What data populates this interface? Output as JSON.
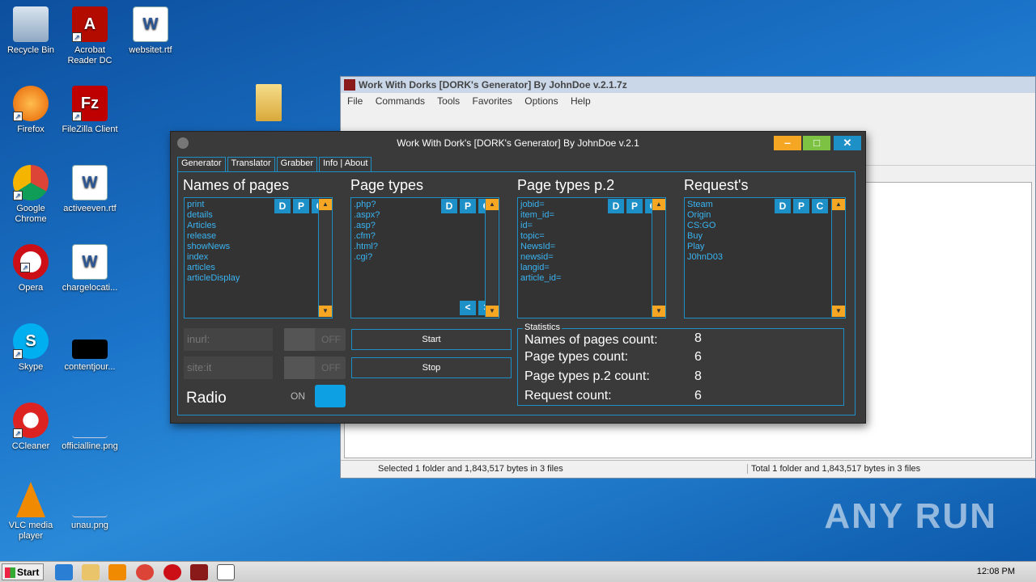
{
  "desktop": {
    "icons": [
      {
        "label": "Recycle Bin",
        "icon": "recycle-bin-icon"
      },
      {
        "label": "Acrobat Reader DC",
        "icon": "acrobat-icon"
      },
      {
        "label": "websitet.rtf",
        "icon": "word-doc-icon"
      },
      {
        "label": "Firefox",
        "icon": "firefox-icon"
      },
      {
        "label": "FileZilla Client",
        "icon": "filezilla-icon"
      },
      {
        "label": "Google Chrome",
        "icon": "chrome-icon"
      },
      {
        "label": "activeeven.rtf",
        "icon": "word-doc-icon"
      },
      {
        "label": "Opera",
        "icon": "opera-icon"
      },
      {
        "label": "chargelocati...",
        "icon": "word-doc-icon"
      },
      {
        "label": "Skype",
        "icon": "skype-icon"
      },
      {
        "label": "contentjour...",
        "icon": "image-file-icon"
      },
      {
        "label": "CCleaner",
        "icon": "ccleaner-icon"
      },
      {
        "label": "officialline.png",
        "icon": "image-file-icon"
      },
      {
        "label": "VLC media player",
        "icon": "vlc-icon"
      },
      {
        "label": "unau.png",
        "icon": "image-file-icon"
      }
    ]
  },
  "zip_window": {
    "title": "Work With Dorks [DORK's Generator] By JohnDoe v.2.1.7z",
    "menu": [
      "File",
      "Commands",
      "Tools",
      "Favorites",
      "Options",
      "Help"
    ],
    "status_left": "Selected 1 folder and 1,843,517 bytes in 3 files",
    "status_right": "Total 1 folder and 1,843,517 bytes in 3 files"
  },
  "app": {
    "title": "Work With Dork's [DORK's Generator] By JohnDoe v.2.1",
    "tabs": [
      "Generator",
      "Translator",
      "Grabber",
      "Info | About"
    ],
    "dpc": [
      "D",
      "P",
      "C"
    ],
    "columns": [
      {
        "header": "Names of pages",
        "items": [
          "print",
          "details",
          "Articles",
          "release",
          "showNews",
          "index",
          "articles",
          "articleDisplay"
        ]
      },
      {
        "header": "Page types",
        "items": [
          ".php?",
          ".aspx?",
          ".asp?",
          ".cfm?",
          ".html?",
          ".cgi?"
        ]
      },
      {
        "header": "Page types p.2",
        "items": [
          "jobid=",
          "item_id=",
          "id=",
          "topic=",
          "NewsId=",
          "newsid=",
          "langid=",
          "article_id="
        ]
      },
      {
        "header": "Request's",
        "items": [
          "Steam",
          "Origin",
          "CS:GO",
          "Buy",
          "Play",
          "J0hnD03"
        ]
      }
    ],
    "nav": {
      "prev": "<",
      "next": ">"
    },
    "inurl": {
      "label": "inurl:",
      "toggle": "OFF"
    },
    "siteit": {
      "label": "site:it",
      "toggle": "OFF"
    },
    "radio": {
      "label": "Radio",
      "toggle": "ON"
    },
    "start_label": "Start",
    "stop_label": "Stop",
    "stats": {
      "legend": "Statistics",
      "rows": [
        {
          "label": "Names of pages count:",
          "value": "8"
        },
        {
          "label": "Page types count:",
          "value": "6"
        },
        {
          "label": "Page types p.2 count:",
          "value": "8"
        },
        {
          "label": "Request count:",
          "value": "6"
        }
      ]
    }
  },
  "taskbar": {
    "start": "Start",
    "clock": "12:08 PM"
  },
  "watermark": "ANY RUN",
  "colors": {
    "accent": "#1e90c8",
    "scroll": "#f5a623",
    "minimize": "#f5a623",
    "maximize": "#7dc242",
    "close": "#1e90c8"
  }
}
